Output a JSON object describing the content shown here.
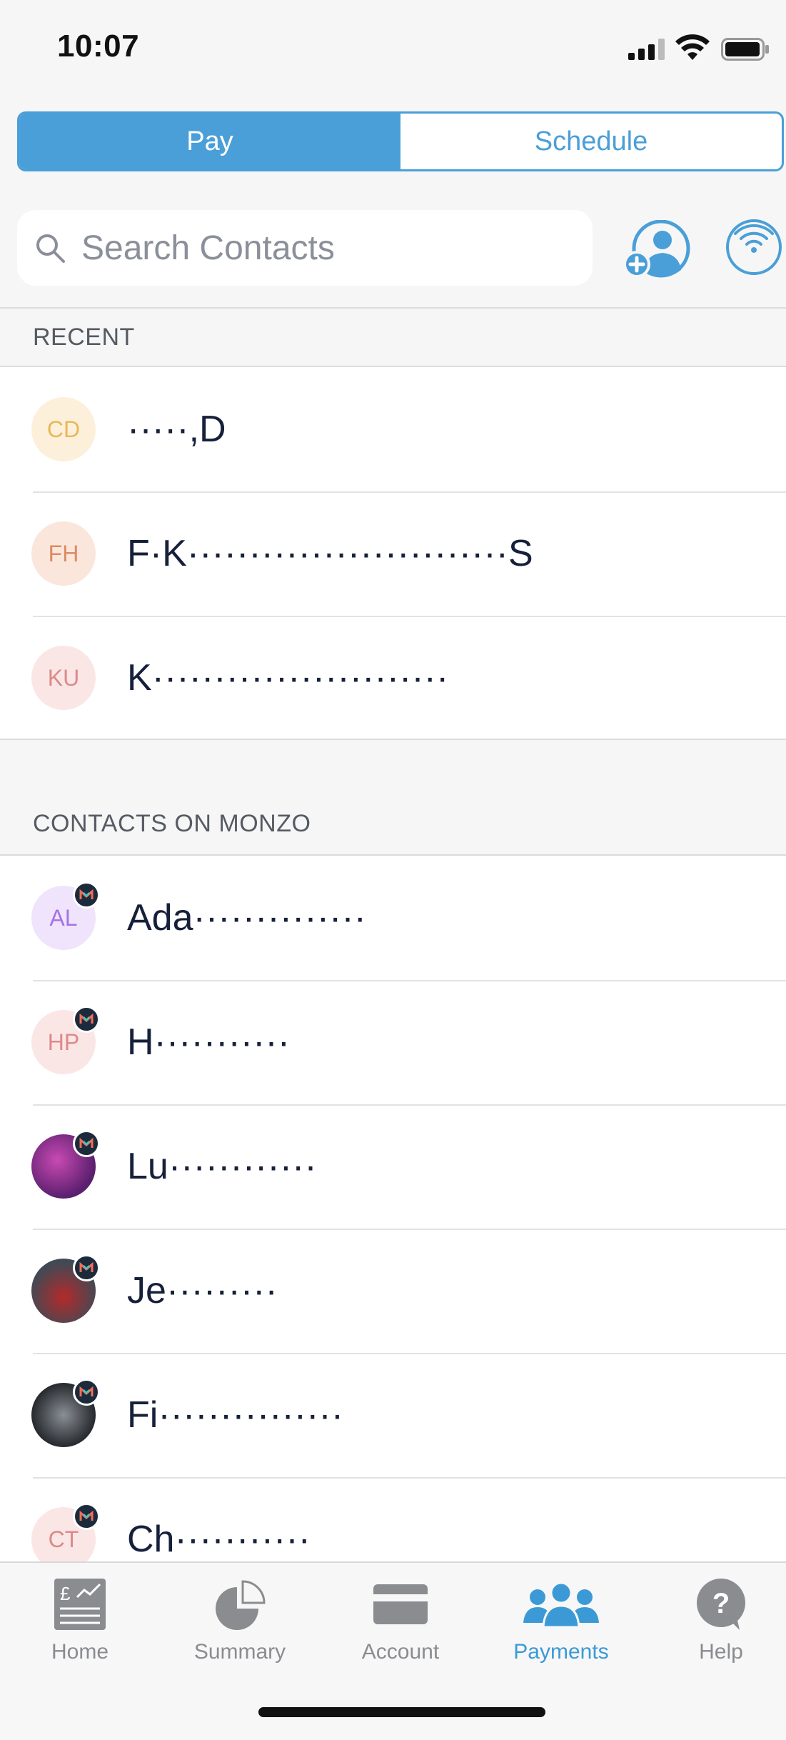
{
  "status_bar": {
    "time": "10:07"
  },
  "segmented": {
    "pay": "Pay",
    "schedule": "Schedule",
    "active": "pay"
  },
  "search": {
    "placeholder": "Search Contacts",
    "value": ""
  },
  "recent": {
    "header": "RECENT",
    "items": [
      {
        "initials": "CD",
        "name": "·····,D"
      },
      {
        "initials": "FH",
        "name": "F·K··························S"
      },
      {
        "initials": "KU",
        "name": "K························"
      }
    ]
  },
  "monzo_contacts": {
    "header": "CONTACTS ON MONZO",
    "items": [
      {
        "initials": "AL",
        "name": "Ada··············"
      },
      {
        "initials": "HP",
        "name": "H···········"
      },
      {
        "initials": "",
        "name": "Lu············"
      },
      {
        "initials": "",
        "name": "Je·········"
      },
      {
        "initials": "",
        "name": "Fi···············"
      },
      {
        "initials": "CT",
        "name": "Ch···········"
      }
    ]
  },
  "tabbar": {
    "home": "Home",
    "summary": "Summary",
    "account": "Account",
    "payments": "Payments",
    "help": "Help",
    "active": "payments"
  },
  "colors": {
    "accent": "#4a9fd8",
    "text": "#16203a",
    "tab_inactive": "#8a8c90"
  }
}
